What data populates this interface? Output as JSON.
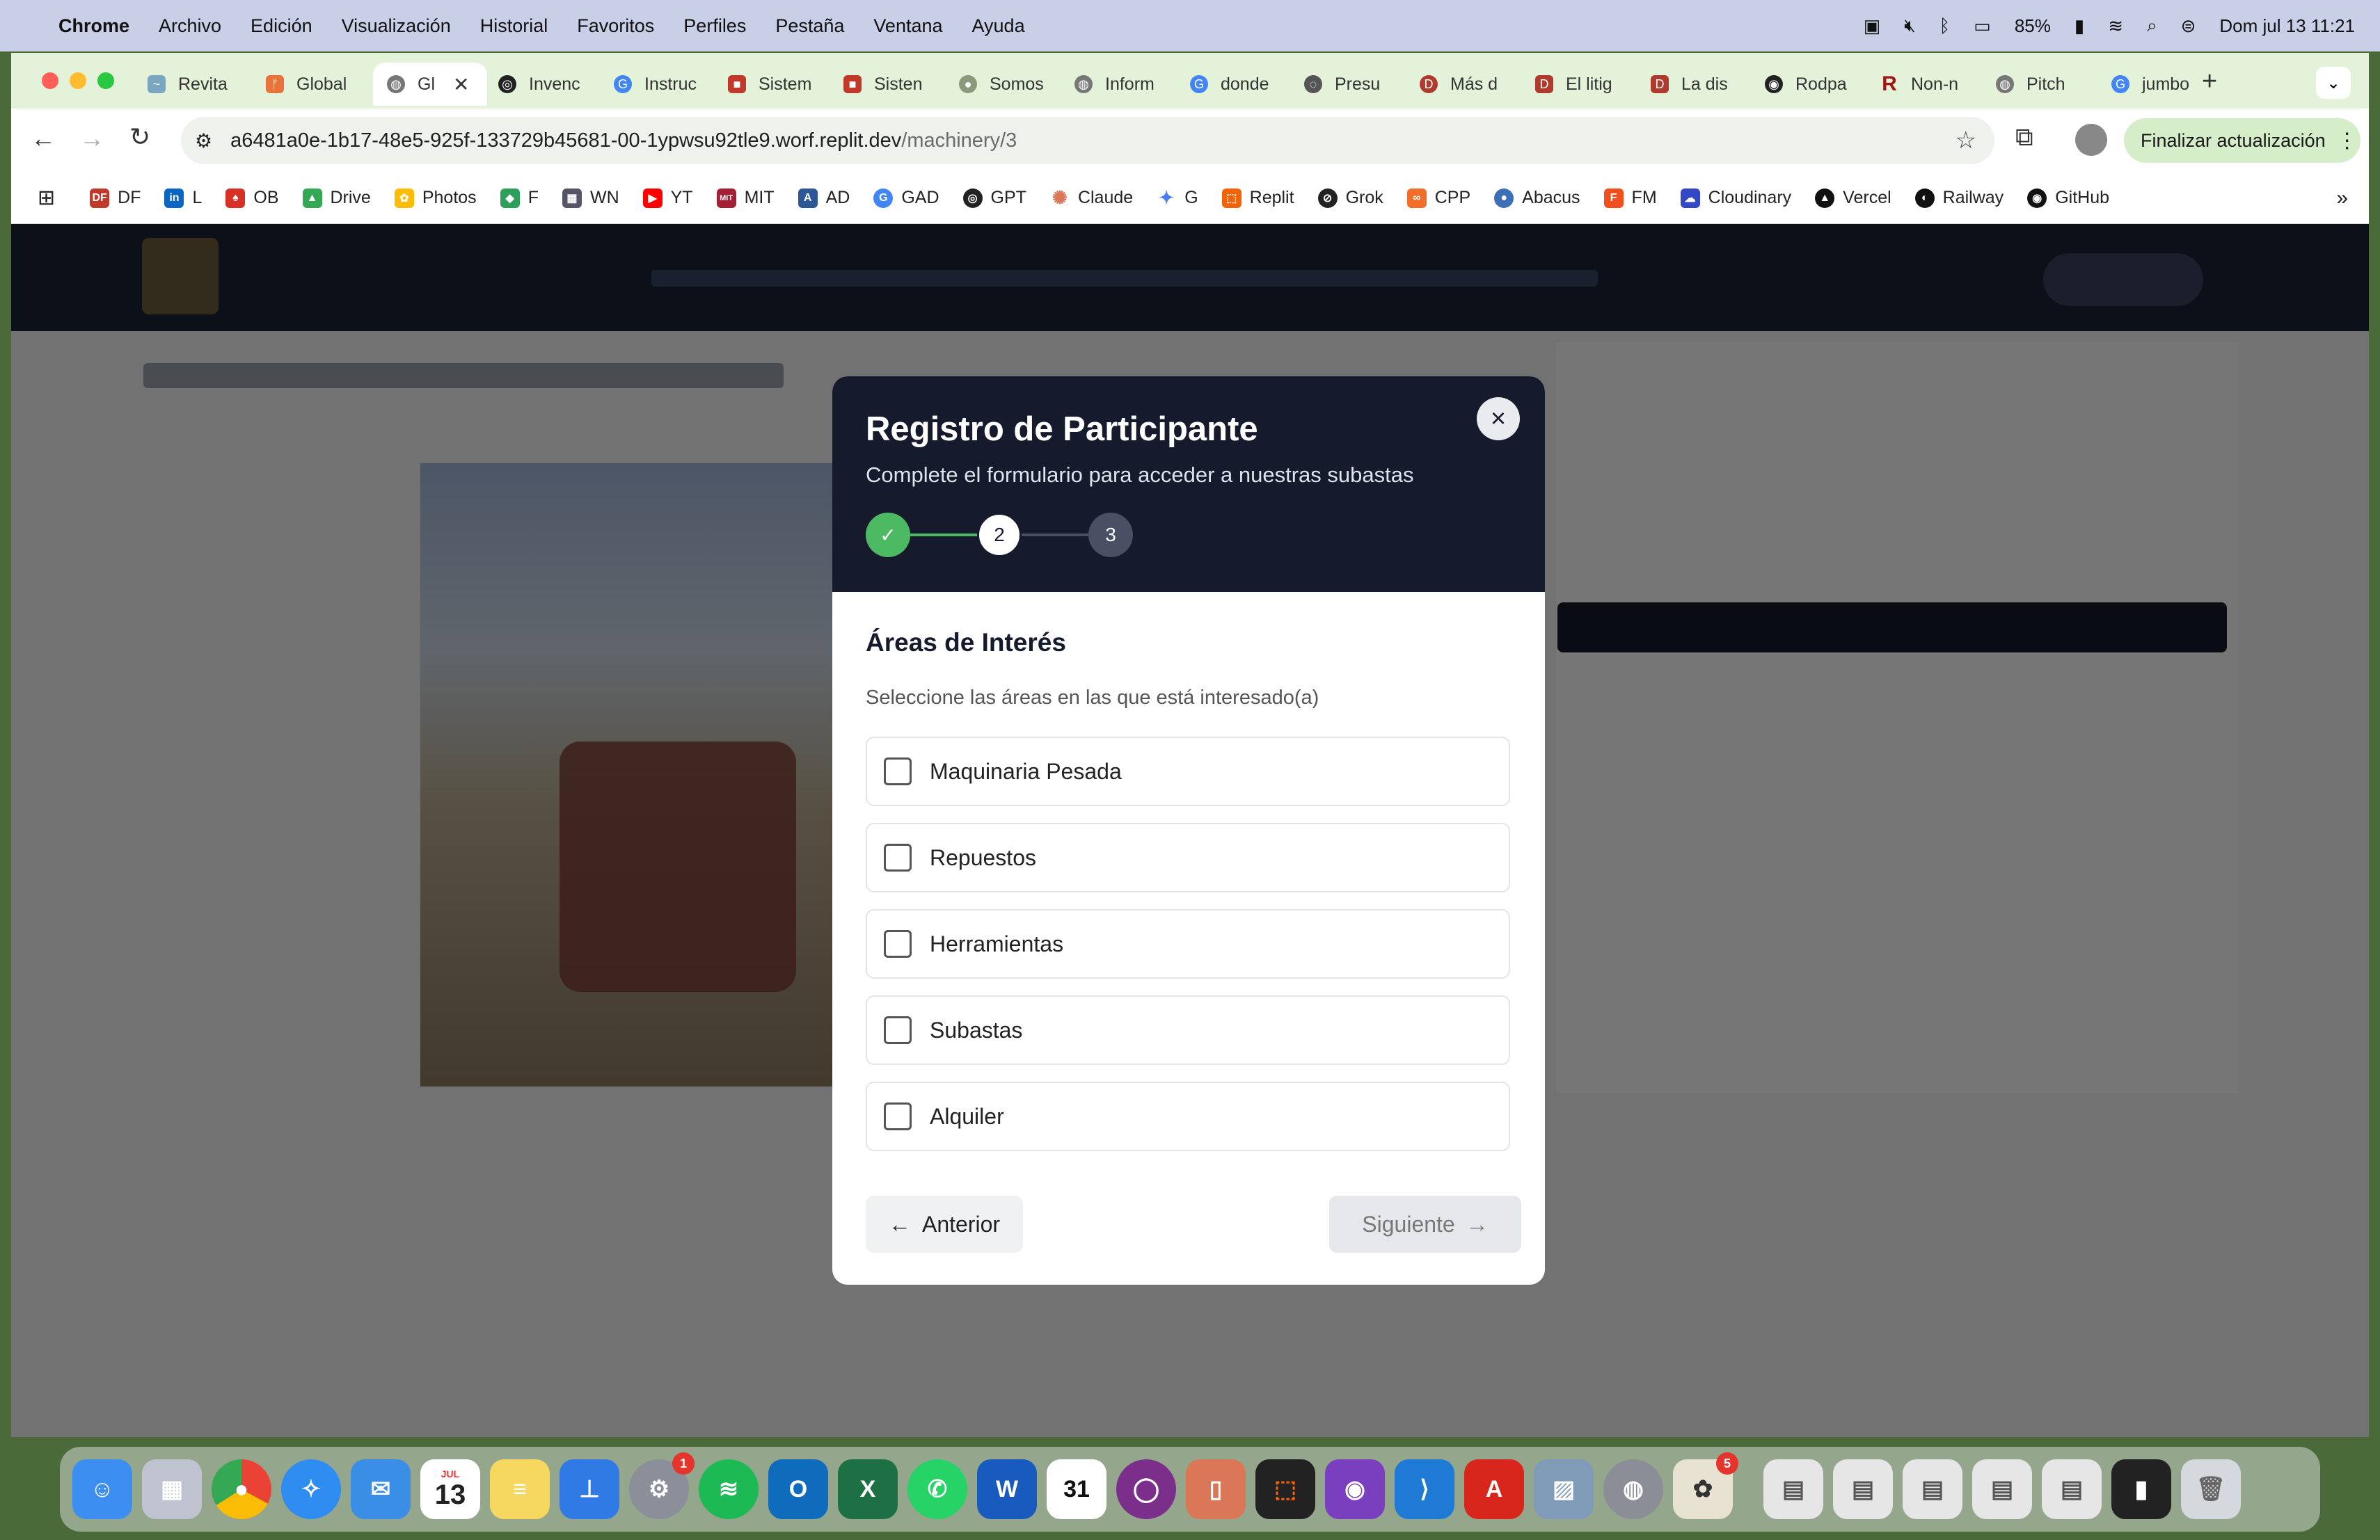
{
  "menubar": {
    "apple": "",
    "app": "Chrome",
    "items": [
      "Archivo",
      "Edición",
      "Visualización",
      "Historial",
      "Favoritos",
      "Perfiles",
      "Pestaña",
      "Ventana",
      "Ayuda"
    ],
    "battery": "85%",
    "datetime": "Dom jul 13  11:21"
  },
  "tabs": [
    "Revita",
    "Global",
    "Gl",
    "Invenc",
    "Instruc",
    "Sistem",
    "Sisten",
    "Somos",
    "Inform",
    "donde",
    "Presu",
    "Más d",
    "El litig",
    "La dis",
    "Rodpa",
    "Non-n",
    "Pitch",
    "jumbo"
  ],
  "toolbar": {
    "url_host": "a6481a0e-1b17-48e5-925f-133729b45681-00-1ypwsu92tle9.worf.replit.dev",
    "url_path": "/machinery/3",
    "update_label": "Finalizar actualización"
  },
  "bookmarks": [
    "DF",
    "L",
    "OB",
    "Drive",
    "Photos",
    "F",
    "WN",
    "YT",
    "MIT",
    "AD",
    "GAD",
    "GPT",
    "Claude",
    "G",
    "Replit",
    "Grok",
    "CPP",
    "Abacus",
    "FM",
    "Cloudinary",
    "Vercel",
    "Railway",
    "GitHub"
  ],
  "modal": {
    "title": "Registro de Participante",
    "subtitle": "Complete el formulario para acceder a nuestras subastas",
    "steps": [
      "✓",
      "2",
      "3"
    ],
    "close": "×",
    "section_title": "Áreas de Interés",
    "section_hint": "Seleccione las áreas en las que está interesado(a)",
    "options": [
      "Maquinaria Pesada",
      "Repuestos",
      "Herramientas",
      "Subastas",
      "Alquiler"
    ],
    "prev_label": "Anterior",
    "next_label": "Siguiente"
  },
  "colors": {
    "menubar": "#c9cfe6",
    "chrome_tabstrip": "#e3f2d8",
    "modal_header": "#151b2c",
    "step_done": "#4cb963",
    "accent_dark": "#151b2c"
  },
  "dock": {
    "calendar_month": "JUL",
    "calendar_day": "13",
    "badge_settings": "1",
    "badge_store": "5"
  }
}
